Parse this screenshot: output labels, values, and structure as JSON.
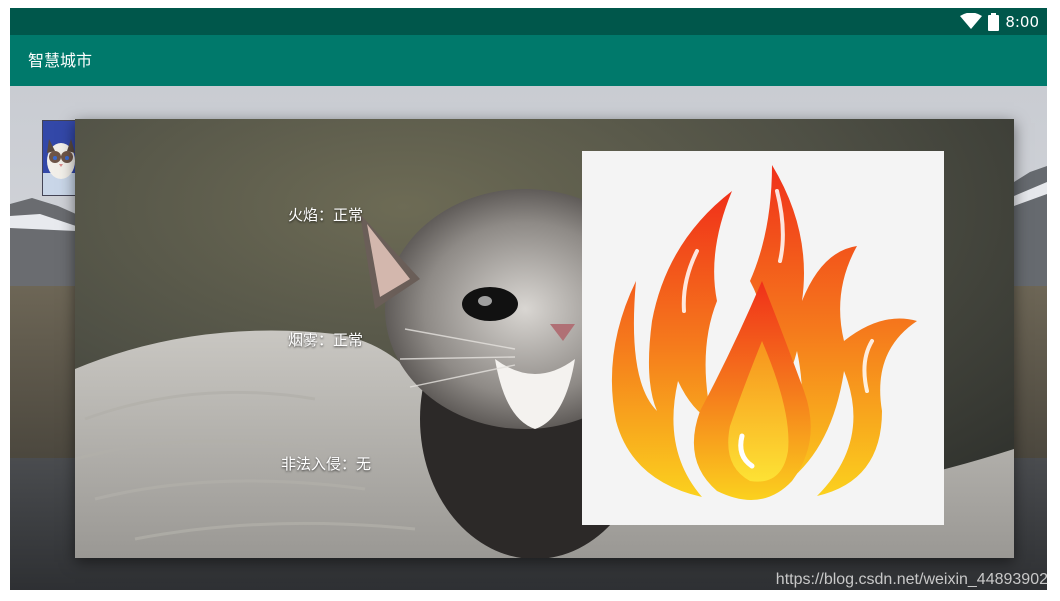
{
  "status_bar": {
    "time": "8:00",
    "icons": [
      "wifi-icon",
      "battery-icon"
    ]
  },
  "app_bar": {
    "title": "智慧城市"
  },
  "dialog": {
    "flame_status": "火焰：正常",
    "smoke_status": "烟雾：正常",
    "intrusion_status": "非法入侵：无",
    "image_icon": "fire-icon"
  },
  "watermark": "https://blog.csdn.net/weixin_44893902",
  "colors": {
    "status_bar": "#00574b",
    "app_bar": "#00796b"
  }
}
